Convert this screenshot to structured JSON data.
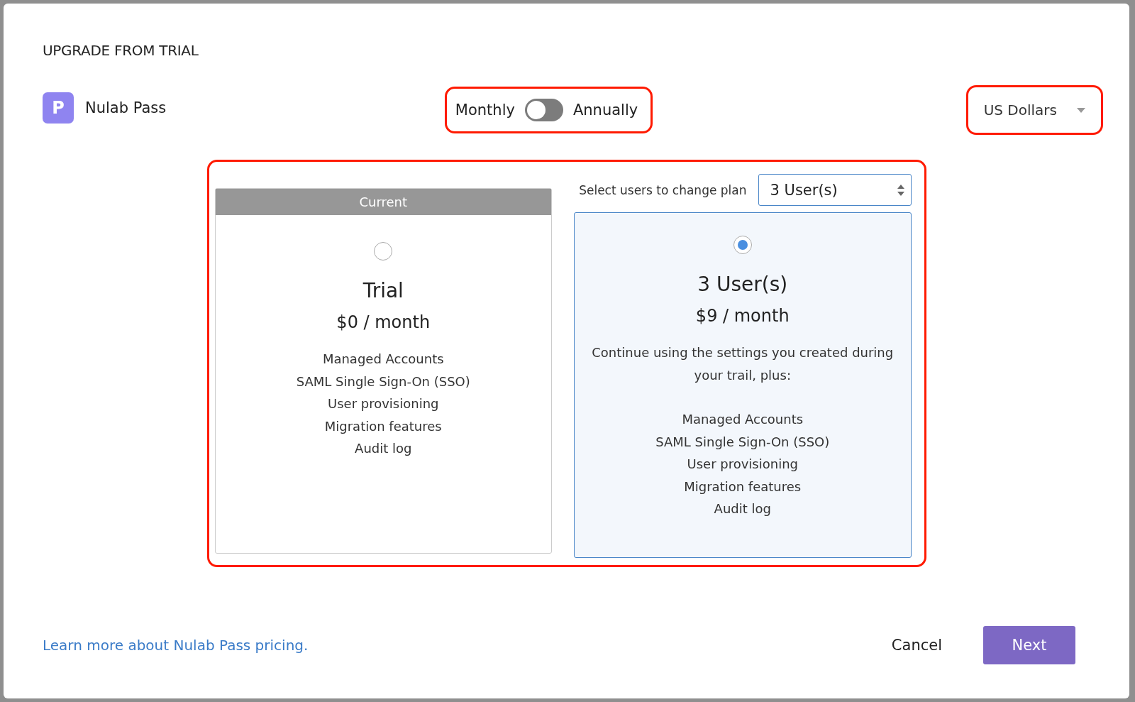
{
  "dialog": {
    "title": "UPGRADE FROM TRIAL"
  },
  "product": {
    "logo_letter": "P",
    "name": "Nulab Pass"
  },
  "billing_toggle": {
    "left_label": "Monthly",
    "right_label": "Annually",
    "on": false,
    "highlighted": true
  },
  "currency": {
    "value": "US Dollars",
    "highlighted": true
  },
  "plans_area": {
    "highlighted": true,
    "users_label": "Select users to change plan",
    "users_select": "3 User(s)"
  },
  "plans": [
    {
      "badge": "Current",
      "selected": false,
      "name": "Trial",
      "price": "$0 / month",
      "features": [
        "Managed Accounts",
        "SAML Single Sign-On (SSO)",
        "User provisioning",
        "Migration features",
        "Audit log"
      ]
    },
    {
      "selected": true,
      "name": "3 User(s)",
      "price": "$9 / month",
      "intro": "Continue using the settings you created during your trail, plus:",
      "features": [
        "Managed Accounts",
        "SAML Single Sign-On (SSO)",
        "User provisioning",
        "Migration features",
        "Audit log"
      ]
    }
  ],
  "footer": {
    "link": "Learn more about Nulab Pass pricing.",
    "cancel": "Cancel",
    "next": "Next"
  }
}
